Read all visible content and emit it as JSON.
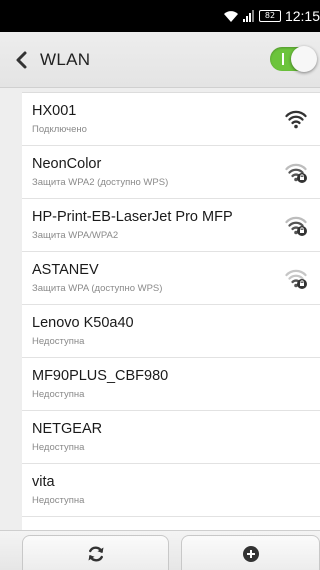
{
  "status_bar": {
    "battery": "82",
    "time": "12:15"
  },
  "header": {
    "title": "WLAN",
    "wifi_enabled": true,
    "accent_color": "#6cc43c"
  },
  "networks": [
    {
      "name": "HX001",
      "status": "Подключено",
      "signal_icon": "wifi-connected-icon",
      "secured": false,
      "strength": 1.0
    },
    {
      "name": "NeonColor",
      "status": "Защита WPA2 (доступно WPS)",
      "signal_icon": "wifi-locked-icon",
      "secured": true,
      "strength": 0.75
    },
    {
      "name": "HP-Print-EB-LaserJet Pro MFP",
      "status": "Защита WPA/WPA2",
      "signal_icon": "wifi-locked-icon",
      "secured": true,
      "strength": 0.75
    },
    {
      "name": "ASTANEV",
      "status": "Защита WPA (доступно WPS)",
      "signal_icon": "wifi-locked-icon",
      "secured": true,
      "strength": 0.5
    },
    {
      "name": "Lenovo K50a40",
      "status": "Недоступна"
    },
    {
      "name": "MF90PLUS_CBF980",
      "status": "Недоступна"
    },
    {
      "name": "NETGEAR",
      "status": "Недоступна"
    },
    {
      "name": "vita",
      "status": "Недоступна"
    }
  ],
  "bottom_bar": {
    "refresh_icon": "refresh-icon",
    "add_icon": "add-network-icon"
  }
}
